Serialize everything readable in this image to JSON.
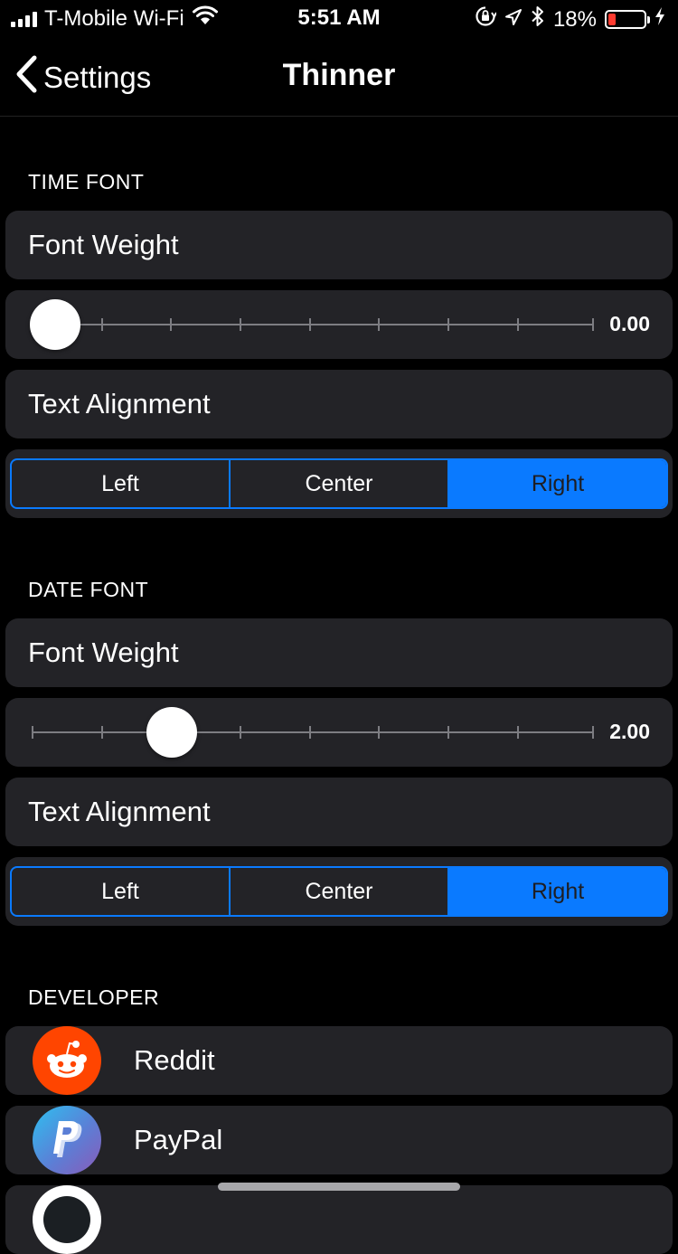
{
  "status_bar": {
    "carrier": "T-Mobile Wi-Fi",
    "time": "5:51 AM",
    "battery": "18%",
    "icons": [
      "signal-icon",
      "wifi-icon",
      "orientation-lock-icon",
      "location-icon",
      "bluetooth-icon",
      "battery-icon",
      "charging-icon"
    ],
    "battery_color": "#ff3b30"
  },
  "nav": {
    "back_label": "Settings",
    "title": "Thinner"
  },
  "sections": {
    "time_font": {
      "header": "TIME FONT",
      "weight_label": "Font Weight",
      "weight_value": "0.00",
      "weight_fraction": 0.0,
      "alignment_label": "Text Alignment",
      "alignment_options": [
        "Left",
        "Center",
        "Right"
      ],
      "alignment_selected": "Right"
    },
    "date_font": {
      "header": "DATE FONT",
      "weight_label": "Font Weight",
      "weight_value": "2.00",
      "weight_fraction": 0.25,
      "alignment_label": "Text Alignment",
      "alignment_options": [
        "Left",
        "Center",
        "Right"
      ],
      "alignment_selected": "Right"
    },
    "developer": {
      "header": "DEVELOPER",
      "items": [
        {
          "label": "Reddit",
          "icon": "reddit-icon",
          "color": "#ff4500"
        },
        {
          "label": "PayPal",
          "icon": "paypal-icon",
          "color": "#4a8fd8"
        },
        {
          "icon": "github-icon"
        }
      ]
    }
  },
  "colors": {
    "accent": "#0a7aff",
    "cell_background": "#232327",
    "background": "#000000"
  }
}
